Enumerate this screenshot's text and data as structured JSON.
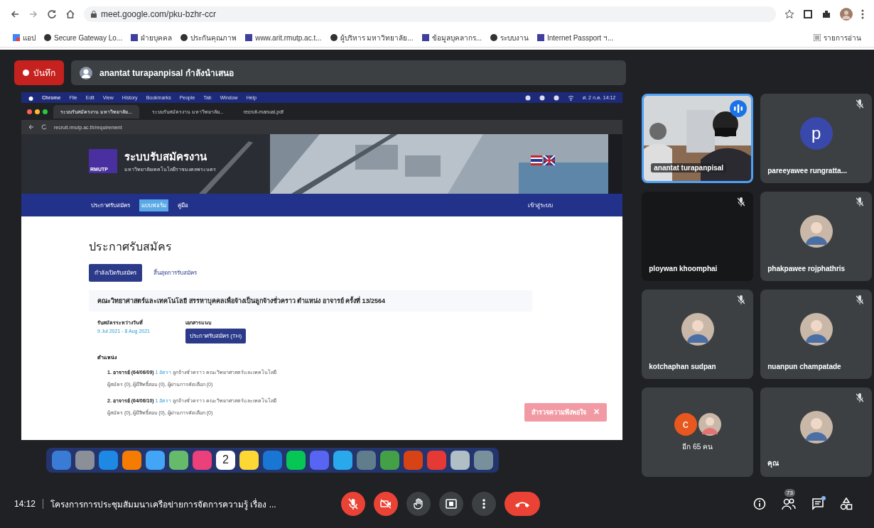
{
  "browser": {
    "url": "meet.google.com/pku-bzhr-ccr",
    "bookmarks": [
      "แอป",
      "Secure Gateway Lo...",
      "ฝ่ายบุคคล",
      "ประกันคุณภาพ",
      "www.arit.rmutp.ac.t...",
      "ผู้บริหาร มหาวิทยาลัย...",
      "ข้อมูลบุคลากร...",
      "ระบบงาน",
      "Internet Passport ฯ..."
    ],
    "reading_list": "รายการอ่าน"
  },
  "meet_header": {
    "record_label": "บันทึก",
    "presenter": "anantat turapanpisal กำลังนำเสนอ"
  },
  "shared_screen": {
    "menu": [
      "Chrome",
      "File",
      "Edit",
      "View",
      "History",
      "Bookmarks",
      "People",
      "Tab",
      "Window",
      "Help"
    ],
    "clock": "ศ. 2 ก.ค. 14:12",
    "tabs": [
      {
        "title": "ระบบรับสมัครงาน มหาวิทยาลัย...",
        "selected": true
      },
      {
        "title": "ระบบรับสมัครงาน มหาวิทยาลัย...",
        "selected": false
      },
      {
        "title": "recruit-manual.pdf",
        "selected": false
      }
    ],
    "url": "recruit.rmutp.ac.th/requirement",
    "site": {
      "logo": "RMUTP",
      "title": "ระบบรับสมัครงาน",
      "subtitle": "มหาวิทยาลัยเทคโนโลยีราชมงคลพระนคร",
      "nav": [
        {
          "label": "ประกาศรับสมัคร",
          "selected": false
        },
        {
          "label": "แบบฟอร์ม",
          "selected": true
        },
        {
          "label": "คู่มือ",
          "selected": false
        }
      ],
      "login": "เข้าสู่ระบบ",
      "heading": "ประกาศรับสมัคร",
      "filters": [
        {
          "label": "กำลังเปิดรับสมัคร",
          "selected": true
        },
        {
          "label": "สิ้นสุดการรับสมัคร",
          "selected": false
        }
      ],
      "announcement": {
        "title": "คณะวิทยาศาสตร์และเทคโนโลยี สรรหาบุคคลเพื่อจ้างเป็นลูกจ้างชั่วคราว ตำแหน่ง อาจารย์ ครั้งที่ 13/2564",
        "period_label": "รับสมัครระหว่างวันที่",
        "period": "9 Jul 2021 - 8 Aug 2021",
        "attachment_label": "เอกสารแนบ",
        "attachment": "ประกาศรับสมัคร (TH)",
        "positions_label": "ตำแหน่ง",
        "positions": [
          {
            "title": "1. อาจารย์ (64/06/09)",
            "count": "1 อัตรา",
            "detail": "ลูกจ้างชั่วคราว คณะวิทยาศาสตร์และเทคโนโลยี",
            "stats": "ผู้สมัคร (0), ผู้มีสิทธิ์สอบ (0), ผู้ผ่านการคัดเลือก (0)"
          },
          {
            "title": "2. อาจารย์ (64/06/10)",
            "count": "1 อัตรา",
            "detail": "ลูกจ้างชั่วคราว คณะวิทยาศาสตร์และเทคโนโลยี",
            "stats": "ผู้สมัคร (0), ผู้มีสิทธิ์สอบ (0), ผู้ผ่านการคัดเลือก (0)"
          }
        ]
      },
      "survey": "สำรวจความพึงพอใจ",
      "survey_close": "✕"
    },
    "dock": [
      {
        "color": "#3a7bd5"
      },
      {
        "color": "#8a8f98"
      },
      {
        "color": "#1e88e5"
      },
      {
        "color": "#f57c00"
      },
      {
        "color": "#42a5f5"
      },
      {
        "color": "#66bb6a"
      },
      {
        "color": "#ec407a"
      },
      {
        "color": "#ffffff",
        "kind": "calendar",
        "text": "2"
      },
      {
        "color": "#fdd835"
      },
      {
        "color": "#1976d2"
      },
      {
        "color": "#06c755"
      },
      {
        "color": "#5865f2"
      },
      {
        "color": "#29a9eb"
      },
      {
        "color": "#607d8b"
      },
      {
        "color": "#43a047"
      },
      {
        "color": "#d84315"
      },
      {
        "color": "#e53935"
      },
      {
        "color": "#b0bec5"
      },
      {
        "color": "#78909c"
      }
    ]
  },
  "participants": [
    {
      "kind": "video",
      "name": "anantat turapanpisal",
      "muted": false,
      "speaking": true
    },
    {
      "kind": "letter",
      "name": "pareeyawee rungratta...",
      "letter": "p",
      "color": "#3949ab",
      "muted": true,
      "speaking": false
    },
    {
      "kind": "blank",
      "name": "ploywan khoomphai",
      "muted": true,
      "speaking": false
    },
    {
      "name": "phakpawee rojphathris",
      "muted": true,
      "speaking": false
    },
    {
      "name": "kotchaphan sudpan",
      "muted": true,
      "speaking": false
    },
    {
      "name": "nuanpun champatade",
      "muted": true,
      "speaking": false
    },
    {
      "kind": "overflow",
      "name": "อีก 65 คน",
      "letter": "c",
      "color": "#e8571e",
      "muted": false,
      "speaking": false
    },
    {
      "name": "คุณ",
      "muted": true,
      "speaking": false
    }
  ],
  "bottom_bar": {
    "time": "14:12",
    "meeting_title": "โครงการการประชุมสัมมนาเครือข่ายการจัดการความรู้ เรื่อง ...",
    "mic_off": true,
    "camera_off": true,
    "people_count": "73",
    "chat_unread": true
  }
}
